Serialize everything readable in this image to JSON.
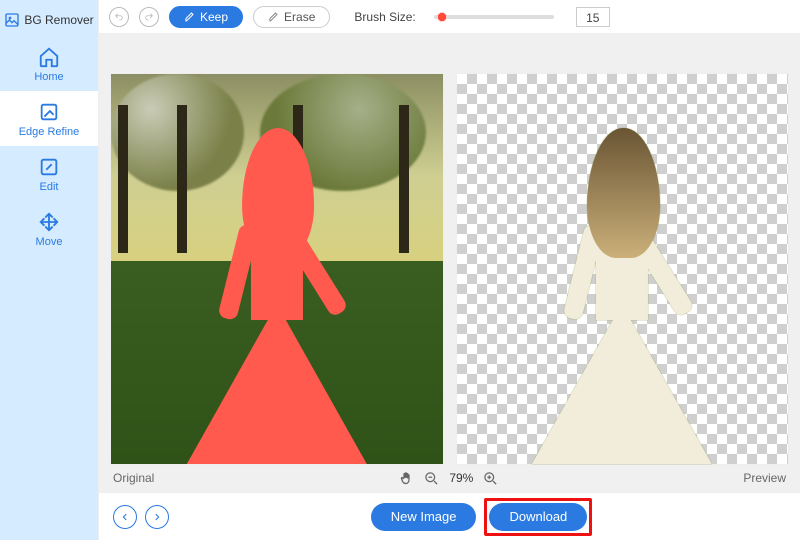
{
  "brand": {
    "name": "BG Remover"
  },
  "sidebar": {
    "items": [
      {
        "label": "Home"
      },
      {
        "label": "Edge Refine"
      },
      {
        "label": "Edit"
      },
      {
        "label": "Move"
      }
    ],
    "active_index": 1
  },
  "toolbar": {
    "keep_label": "Keep",
    "erase_label": "Erase",
    "brush_label": "Brush Size:",
    "brush_value": "15"
  },
  "canvas": {
    "original_label": "Original",
    "preview_label": "Preview",
    "zoom_value": "79%"
  },
  "actions": {
    "new_image_label": "New Image",
    "download_label": "Download"
  },
  "colors": {
    "accent": "#2a7ae2",
    "sidebar_bg": "#d5ebff",
    "mask": "#ff5a4d",
    "highlight": "#e11"
  }
}
